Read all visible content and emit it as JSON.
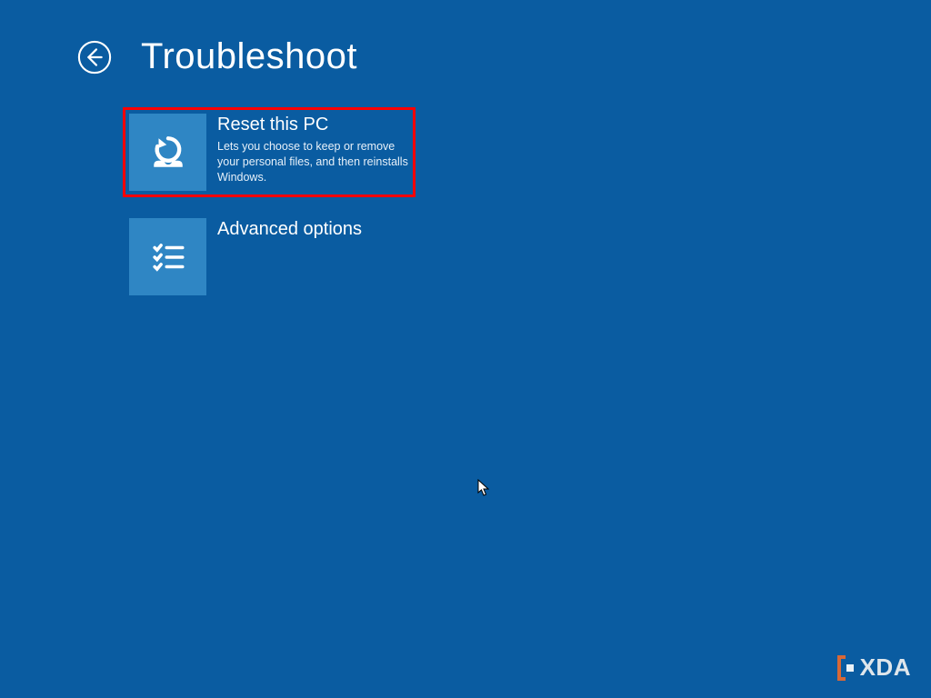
{
  "header": {
    "title": "Troubleshoot"
  },
  "tiles": [
    {
      "title": "Reset this PC",
      "description": "Lets you choose to keep or remove your personal files, and then reinstalls Windows.",
      "highlighted": true
    },
    {
      "title": "Advanced options",
      "description": "",
      "highlighted": false
    }
  ],
  "watermark": {
    "text": "XDA"
  }
}
